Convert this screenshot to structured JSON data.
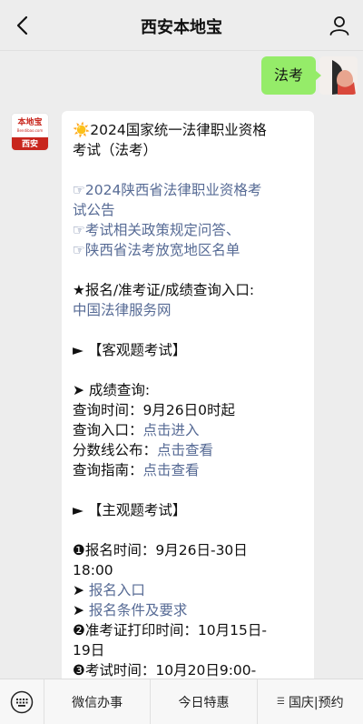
{
  "header": {
    "title": "西安本地宝"
  },
  "chat": {
    "me": {
      "message": "法考"
    },
    "bot": {
      "avatar": {
        "logo": "本地宝",
        "logo_sub": "Bendibao.com",
        "city": "西安"
      },
      "lines": [
        {
          "text": "☀️2024国家统一法律职业资格",
          "type": "text"
        },
        {
          "text": "考试（法考）",
          "type": "text"
        },
        {
          "text": "",
          "type": "gap"
        },
        {
          "text": "☞2024陕西省法律职业资格考",
          "type": "link"
        },
        {
          "text": "试公告",
          "type": "link"
        },
        {
          "text": "☞考试相关政策规定问答、",
          "type": "link"
        },
        {
          "text": "☞陕西省法考放宽地区名单",
          "type": "link"
        },
        {
          "text": "",
          "type": "gap"
        },
        {
          "text": "★报名/准考证/成绩查询入口:",
          "type": "text"
        },
        {
          "text": "中国法律服务网",
          "type": "link"
        },
        {
          "text": "",
          "type": "gap"
        },
        {
          "text": "► 【客观题考试】",
          "type": "text"
        },
        {
          "text": "",
          "type": "gap"
        },
        {
          "text": "➤ 成绩查询:",
          "type": "text"
        },
        {
          "text": "查询时间：9月26日0时起",
          "type": "text"
        },
        {
          "prefix": "查询入口：",
          "link": "点击进入",
          "type": "mixed"
        },
        {
          "prefix": "分数线公布：",
          "link": "点击查看",
          "type": "mixed"
        },
        {
          "prefix": "查询指南：",
          "link": "点击查看",
          "type": "mixed"
        },
        {
          "text": "",
          "type": "gap"
        },
        {
          "text": "► 【主观题考试】",
          "type": "text"
        },
        {
          "text": "",
          "type": "gap"
        },
        {
          "text": "❶报名时间：9月26日-30日",
          "type": "text"
        },
        {
          "text": "18:00",
          "type": "text"
        },
        {
          "prefix": "➤ ",
          "link": "报名入口",
          "type": "mixed"
        },
        {
          "prefix": "➤ ",
          "link": "报名条件及要求",
          "type": "mixed"
        },
        {
          "text": "❷准考证打印时间：10月15日-",
          "type": "text"
        },
        {
          "text": "19日",
          "type": "text"
        },
        {
          "text": "❸考试时间：10月20日9:00-",
          "type": "text"
        }
      ]
    }
  },
  "tabbar": {
    "keyboard_icon": "keyboard-icon",
    "tabs": [
      {
        "label": "微信办事",
        "menu": false
      },
      {
        "label": "今日特惠",
        "menu": false
      },
      {
        "label": "国庆|预约",
        "menu": true
      }
    ]
  },
  "colors": {
    "link": "#576b95",
    "my_bubble": "#95ec69",
    "brand_red": "#c8261d"
  }
}
